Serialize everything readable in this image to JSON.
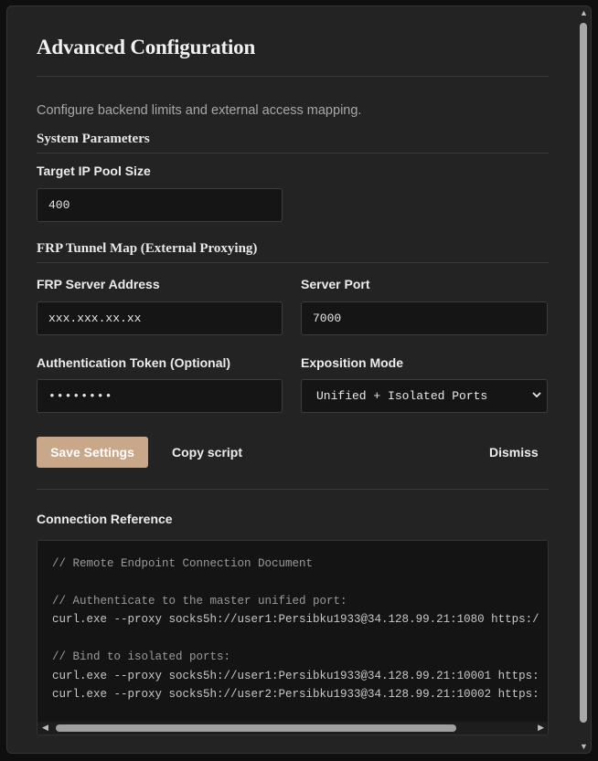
{
  "dialog": {
    "title": "Advanced Configuration",
    "description": "Configure backend limits and external access mapping."
  },
  "system": {
    "heading": "System Parameters",
    "pool_label": "Target IP Pool Size",
    "pool_value": "400"
  },
  "frp": {
    "heading": "FRP Tunnel Map (External Proxying)",
    "server_address_label": "FRP Server Address",
    "server_address_value": "xxx.xxx.xx.xx",
    "server_port_label": "Server Port",
    "server_port_value": "7000",
    "token_label": "Authentication Token (Optional)",
    "token_value": "••••••••",
    "mode_label": "Exposition Mode",
    "mode_value": "Unified + Isolated Ports"
  },
  "actions": {
    "save": "Save Settings",
    "copy": "Copy script",
    "dismiss": "Dismiss"
  },
  "reference": {
    "heading": "Connection Reference",
    "lines": [
      "// Remote Endpoint Connection Document",
      "",
      "// Authenticate to the master unified port:",
      "curl.exe --proxy socks5h://user1:Persibku1933@34.128.99.21:1080 https:/",
      "",
      "// Bind to isolated ports:",
      "curl.exe --proxy socks5h://user1:Persibku1933@34.128.99.21:10001 https:",
      "curl.exe --proxy socks5h://user2:Persibku1933@34.128.99.21:10002 https:"
    ]
  },
  "icons": {
    "select_arrow": "chevron-down-icon",
    "scroll_up": "scroll-up-icon",
    "scroll_down": "scroll-down-icon",
    "scroll_left": "scroll-left-icon",
    "scroll_right": "scroll-right-icon"
  },
  "colors": {
    "primary_button": "#c9a789",
    "dialog_bg": "#232323",
    "input_bg": "#151515"
  }
}
